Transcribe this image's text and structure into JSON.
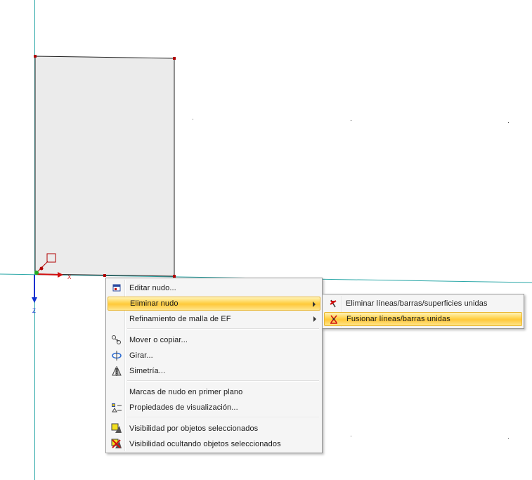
{
  "viewport": {
    "axis_x_label": "X",
    "axis_z_label": "Z"
  },
  "context_menu": {
    "items": [
      {
        "label": "Editar nudo...",
        "icon": "edit-node-icon"
      },
      {
        "label": "Eliminar nudo",
        "icon": "",
        "submenu": true,
        "highlighted": true
      },
      {
        "label": "Refinamiento de malla de EF",
        "icon": "",
        "submenu": true
      },
      {
        "label": "Mover o copiar...",
        "icon": "move-copy-icon"
      },
      {
        "label": "Girar...",
        "icon": "rotate-icon"
      },
      {
        "label": "Simetría...",
        "icon": "mirror-icon"
      },
      {
        "label": "Marcas de nudo en primer plano",
        "icon": ""
      },
      {
        "label": "Propiedades de visualización...",
        "icon": "display-properties-icon"
      },
      {
        "label": "Visibilidad por objetos seleccionados",
        "icon": "visibility-selected-icon"
      },
      {
        "label": "Visibilidad ocultando objetos seleccionados",
        "icon": "visibility-hide-selected-icon"
      }
    ]
  },
  "submenu": {
    "items": [
      {
        "label": "Eliminar líneas/barras/superficies unidas",
        "icon": "delete-lines-icon"
      },
      {
        "label": "Fusionar líneas/barras unidas",
        "icon": "merge-lines-icon",
        "highlighted": true
      }
    ]
  },
  "colors": {
    "axis_line": "#2aa7a7",
    "node": "#b00000",
    "surface_fill": "#ebebeb",
    "highlight": "#ffd24a"
  }
}
